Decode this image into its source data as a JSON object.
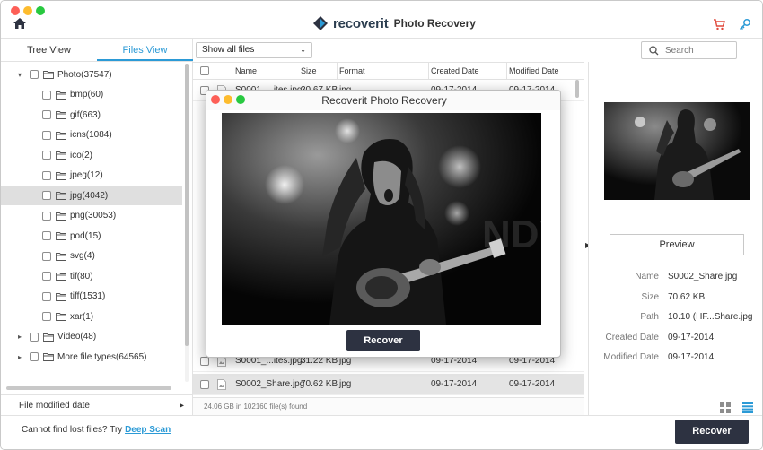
{
  "app": {
    "brand_name": "recoverit",
    "brand_product": "Photo Recovery"
  },
  "icons": {
    "home": "home-icon",
    "cart": "cart-icon",
    "key": "key-icon",
    "folder": "folder-icon",
    "file": "image-file-icon"
  },
  "colors": {
    "accent": "#2b9ad6",
    "button_dark": "#2d3241",
    "cart": "#e1483b"
  },
  "sidebar": {
    "tabs": [
      {
        "label": "Tree View",
        "active": false
      },
      {
        "label": "Files View",
        "active": true
      }
    ],
    "tree": [
      {
        "label": "Photo(37547)",
        "level": 0,
        "expanded": true,
        "arrow": "▾",
        "selected": false
      },
      {
        "label": "bmp(60)",
        "level": 1,
        "selected": false
      },
      {
        "label": "gif(663)",
        "level": 1,
        "selected": false
      },
      {
        "label": "icns(1084)",
        "level": 1,
        "selected": false
      },
      {
        "label": "ico(2)",
        "level": 1,
        "selected": false
      },
      {
        "label": "jpeg(12)",
        "level": 1,
        "selected": false
      },
      {
        "label": "jpg(4042)",
        "level": 1,
        "selected": true
      },
      {
        "label": "png(30053)",
        "level": 1,
        "selected": false
      },
      {
        "label": "pod(15)",
        "level": 1,
        "selected": false
      },
      {
        "label": "svg(4)",
        "level": 1,
        "selected": false
      },
      {
        "label": "tif(80)",
        "level": 1,
        "selected": false
      },
      {
        "label": "tiff(1531)",
        "level": 1,
        "selected": false
      },
      {
        "label": "xar(1)",
        "level": 1,
        "selected": false
      },
      {
        "label": "Video(48)",
        "level": 0,
        "expanded": false,
        "arrow": "▸",
        "selected": false
      },
      {
        "label": "More file types(64565)",
        "level": 0,
        "expanded": false,
        "arrow": "▸",
        "selected": false
      }
    ],
    "filter_label": "File modified date",
    "filter_arrow": "▸"
  },
  "list": {
    "filter_select": "Show all files",
    "columns": [
      "Name",
      "Size",
      "Format",
      "Created Date",
      "Modified Date"
    ],
    "rows": [
      {
        "name": "S0001_...ites.jpg",
        "size": "30.67 KB",
        "format": "jpg",
        "created": "09-17-2014",
        "modified": "09-17-2014",
        "highlight": false
      },
      {
        "name": "S0001_...ites.jpg",
        "size": "31.22 KB",
        "format": "jpg",
        "created": "09-17-2014",
        "modified": "09-17-2014",
        "highlight": false
      },
      {
        "name": "S0002_Share.jpg",
        "size": "70.62 KB",
        "format": "jpg",
        "created": "09-17-2014",
        "modified": "09-17-2014",
        "highlight": true
      }
    ],
    "status": "24.06 GB in 102160 file(s) found"
  },
  "search": {
    "placeholder": "Search"
  },
  "details": {
    "preview_label": "Preview",
    "fields": [
      {
        "key": "Name",
        "value": "S0002_Share.jpg"
      },
      {
        "key": "Size",
        "value": "70.62 KB"
      },
      {
        "key": "Path",
        "value": "10.10 (HF...Share.jpg"
      },
      {
        "key": "Created Date",
        "value": "09-17-2014"
      },
      {
        "key": "Modified Date",
        "value": "09-17-2014"
      }
    ]
  },
  "bottom": {
    "prompt": "Cannot find lost files? Try ",
    "deep_scan": "Deep Scan",
    "recover_label": "Recover"
  },
  "popup": {
    "title": "Recoverit Photo Recovery",
    "recover_label": "Recover"
  }
}
